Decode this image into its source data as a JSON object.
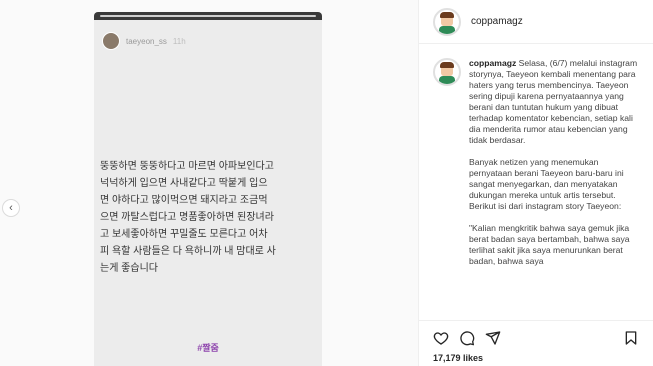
{
  "story": {
    "username": "taeyeon_ss",
    "time": "11h",
    "lines": [
      "뚱뚱하면 뚱뚱하다고 마르면 아파보인다고",
      "넉넉하게 입으면 사내같다고 딱붙게 입으",
      "면 야하다고 많이먹으면 돼지라고 조금먹",
      "으면 까탈스럽다고 명품좋아하면 된장녀라",
      "고 보세좋아하면 꾸밀줄도 모른다고 어차",
      "피 욕할 사람들은 다 욕하니까 내 맘대로 사",
      "는게 좋습니다"
    ],
    "tag": "#짤줌"
  },
  "post": {
    "username": "coppamagz",
    "caption_username": "coppamagz",
    "caption_paragraphs": [
      "Selasa, (6/7) melalui instagram storynya, Taeyeon kembali menentang para haters yang terus membencinya. Taeyeon sering dipuji karena pernyataannya yang berani dan tuntutan hukum yang dibuat terhadap komentator kebencian, setiap kali dia menderita rumor atau kebencian yang tidak berdasar.",
      "Banyak netizen yang menemukan pernyataan berani Taeyeon baru-baru ini sangat menyegarkan, dan menyatakan dukungan mereka untuk artis tersebut. Berikut isi dari instagram story Taeyeon:",
      "\"Kalian mengkritik bahwa saya gemuk jika berat badan saya bertambah, bahwa saya terlihat sakit jika saya menurunkan berat badan, bahwa saya"
    ],
    "likes": "17,179 likes"
  },
  "icons": {
    "prev": "chevron-left-icon",
    "like": "heart-icon",
    "comment": "comment-icon",
    "share": "share-icon",
    "save": "bookmark-icon"
  }
}
